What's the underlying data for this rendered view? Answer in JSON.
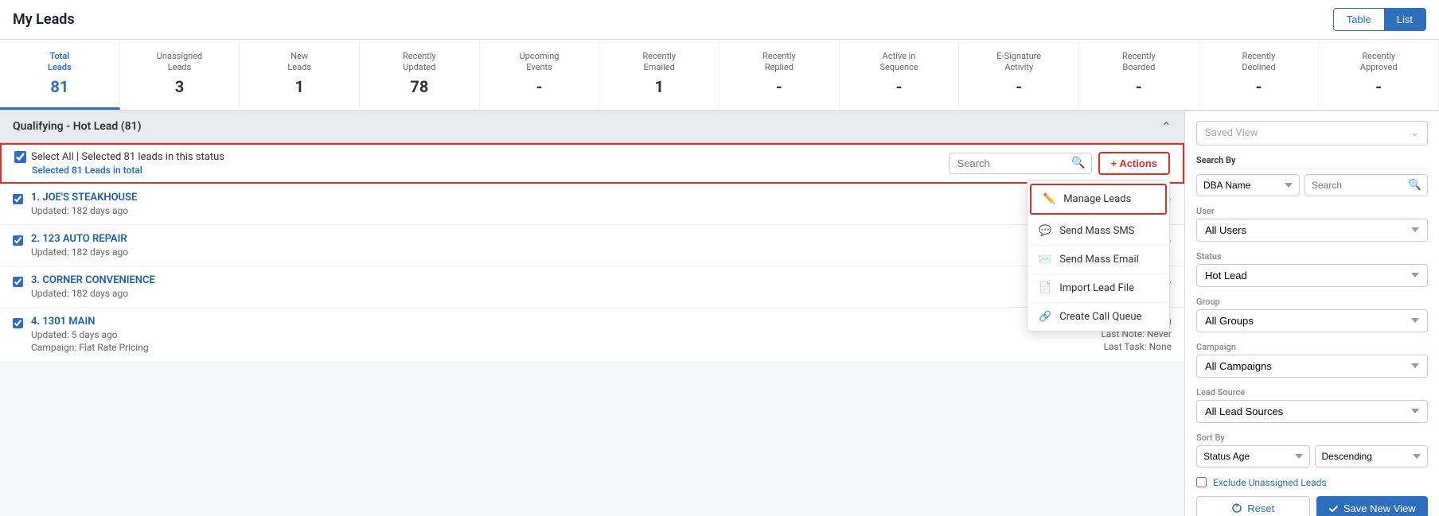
{
  "header": {
    "title": "My Leads",
    "view_toggle": {
      "table_label": "Table",
      "list_label": "List"
    }
  },
  "stats_tabs": [
    {
      "id": "total",
      "label": "Total\nLeads",
      "label1": "Total",
      "label2": "Leads",
      "value": "81",
      "active": true
    },
    {
      "id": "unassigned",
      "label": "Unassigned\nLeads",
      "label1": "Unassigned",
      "label2": "Leads",
      "value": "3",
      "active": false
    },
    {
      "id": "new",
      "label": "New\nLeads",
      "label1": "New",
      "label2": "Leads",
      "value": "1",
      "active": false
    },
    {
      "id": "updated",
      "label": "Recently\nUpdated",
      "label1": "Recently",
      "label2": "Updated",
      "value": "78",
      "active": false
    },
    {
      "id": "events",
      "label": "Upcoming\nEvents",
      "label1": "Upcoming",
      "label2": "Events",
      "value": "-",
      "active": false
    },
    {
      "id": "emailed",
      "label": "Recently\nEmailed",
      "label1": "Recently",
      "label2": "Emailed",
      "value": "1",
      "active": false
    },
    {
      "id": "replied",
      "label": "Recently\nReplied",
      "label1": "Recently",
      "label2": "Replied",
      "value": "-",
      "active": false
    },
    {
      "id": "sequence",
      "label": "Active in\nSequence",
      "label1": "Active in",
      "label2": "Sequence",
      "value": "-",
      "active": false
    },
    {
      "id": "esig",
      "label": "E-Signature\nActivity",
      "label1": "E-Signature",
      "label2": "Activity",
      "value": "-",
      "active": false
    },
    {
      "id": "boarded",
      "label": "Recently\nBoarded",
      "label1": "Recently",
      "label2": "Boarded",
      "value": "-",
      "active": false
    },
    {
      "id": "declined",
      "label": "Recently\nDeclined",
      "label1": "Recently",
      "label2": "Declined",
      "value": "-",
      "active": false
    },
    {
      "id": "approved",
      "label": "Recently\nApproved",
      "label1": "Recently",
      "label2": "Approved",
      "value": "-",
      "active": false
    }
  ],
  "group": {
    "title": "Qualifying - Hot Lead (81)"
  },
  "selection": {
    "main_text": "Select All | Selected 81 leads in this status",
    "sub_text": "Selected",
    "sub_bold": "81 Leads",
    "sub_suffix": "in total"
  },
  "search": {
    "placeholder": "Search"
  },
  "actions_button": "+ Actions",
  "dropdown_items": [
    {
      "id": "manage",
      "icon": "✏️",
      "label": "Manage Leads",
      "highlight": true
    },
    {
      "id": "sms",
      "icon": "💬",
      "label": "Send Mass SMS",
      "highlight": false
    },
    {
      "id": "email",
      "icon": "✉️",
      "label": "Send Mass Email",
      "highlight": false
    },
    {
      "id": "import",
      "icon": "📄",
      "label": "Import Lead File",
      "highlight": false
    },
    {
      "id": "call",
      "icon": "📞",
      "label": "Create Call Queue",
      "highlight": false
    }
  ],
  "leads": [
    {
      "num": "1",
      "name": "JOE'S STEAKHOUSE",
      "meta": "Updated:  182 days ago",
      "right": "(18...",
      "has_right": false
    },
    {
      "num": "2",
      "name": "123 AUTO REPAIR",
      "meta": "Updated:  182 days ago",
      "right": "(18...",
      "has_right": false
    },
    {
      "num": "3",
      "name": "CORNER CONVENIENCE",
      "meta": "Updated:  182 days ago",
      "right": "(18...",
      "has_right": false
    },
    {
      "num": "4",
      "name": "1301 MAIN",
      "meta_updated": "Updated:  5 days ago",
      "meta_campaign": "Campaign:  Flat Rate Pricing",
      "right_status": "(5 days in status)",
      "right_note": "Last Note:  Never",
      "right_task": "Last Task:  None",
      "multi_meta": true
    }
  ],
  "sidebar": {
    "saved_view_placeholder": "Saved View",
    "search_by_label": "Search By",
    "search_by_value": "DBA Name",
    "search_placeholder": "Search",
    "user_label": "User",
    "user_value": "All Users",
    "status_label": "Status",
    "status_value": "Hot Lead",
    "group_label": "Group",
    "group_value": "All Groups",
    "campaign_label": "Campaign",
    "campaign_value": "All Campaigns",
    "lead_source_label": "Lead Source",
    "lead_source_value": "All Lead Sources",
    "sort_by_label": "Sort By",
    "sort_by_value": "Status Age",
    "sort_order_value": "Descending",
    "exclude_label": "Exclude Unassigned Leads",
    "reset_label": "Reset",
    "save_view_label": "Save New View"
  }
}
